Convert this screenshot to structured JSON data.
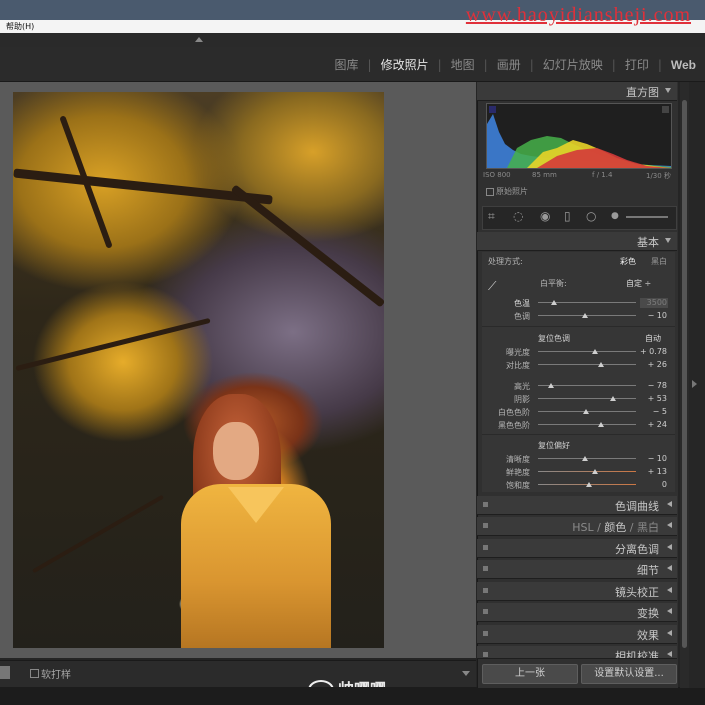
{
  "menu": {
    "help": "帮助(H)"
  },
  "watermark": "www.haoyidiansheji.com",
  "window_controls": [
    "_",
    "□",
    "×"
  ],
  "modules": [
    {
      "label": "图库",
      "active": false
    },
    {
      "label": "修改照片",
      "active": true
    },
    {
      "label": "地图",
      "active": false
    },
    {
      "label": "画册",
      "active": false
    },
    {
      "label": "幻灯片放映",
      "active": false
    },
    {
      "label": "打印",
      "active": false
    },
    {
      "label": "Web",
      "active": false
    }
  ],
  "histogram": {
    "title": "直方图",
    "iso": "ISO 800",
    "focal": "85 mm",
    "aperture": "f / 1.4",
    "shutter": "1/30 秒",
    "original_photo": "原始照片"
  },
  "basic": {
    "title": "基本",
    "treatment_label": "处理方式:",
    "color": "彩色",
    "bw": "黑白",
    "wb_label": "白平衡:",
    "wb_value": "自定 ÷",
    "temp_label": "色温",
    "temp_value": "3500",
    "tint_label": "色调",
    "tint_value": "− 10",
    "tone_label": "复位色调",
    "auto": "自动",
    "exposure_label": "曝光度",
    "exposure_value": "+ 0.78",
    "contrast_label": "对比度",
    "contrast_value": "+ 26",
    "highlights_label": "高光",
    "highlights_value": "− 78",
    "shadows_label": "阴影",
    "shadows_value": "+ 53",
    "whites_label": "白色色阶",
    "whites_value": "− 5",
    "blacks_label": "黑色色阶",
    "blacks_value": "+ 24",
    "presence_label": "复位偏好",
    "clarity_label": "清晰度",
    "clarity_value": "− 10",
    "vibrance_label": "鲜艳度",
    "vibrance_value": "+ 13",
    "saturation_label": "饱和度",
    "saturation_value": "0"
  },
  "panels": {
    "tone_curve": "色调曲线",
    "hsl": "HSL",
    "hsl_color": "颜色",
    "hsl_bw": "黑白",
    "split": "分离色调",
    "detail": "细节",
    "lens": "镜头校正",
    "transform": "变换",
    "effects": "效果",
    "calibration": "相机校准"
  },
  "buttons": {
    "prev": "上一张",
    "defaults": "设置默认设置..."
  },
  "toolbar": {
    "soft_proof": "软打样"
  },
  "weibo": "帅嘤嘤"
}
